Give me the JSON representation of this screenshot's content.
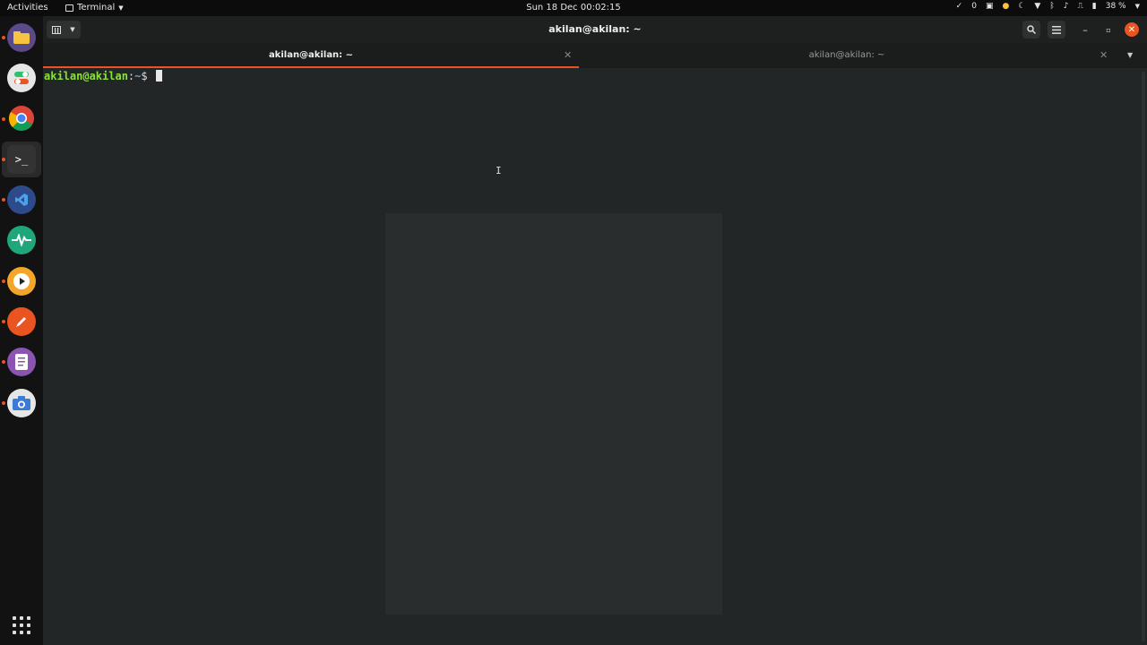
{
  "topbar": {
    "activities": "Activities",
    "app_name": "Terminal",
    "clock": "Sun 18 Dec  00:02:15",
    "notification_count": "0",
    "battery": "38 %"
  },
  "dock": {
    "items": [
      {
        "name": "files-icon",
        "color": "#f6c342"
      },
      {
        "name": "settings-toggle-icon",
        "color": "#e6e6e6"
      },
      {
        "name": "chrome-icon",
        "color": "#4285f4"
      },
      {
        "name": "terminal-icon",
        "color": "#333333"
      },
      {
        "name": "vscode-icon",
        "color": "#2d67b4"
      },
      {
        "name": "system-monitor-icon",
        "color": "#2fbf71"
      },
      {
        "name": "media-player-icon",
        "color": "#f4a62a"
      },
      {
        "name": "pen-tool-icon",
        "color": "#e95420"
      },
      {
        "name": "text-editor-icon",
        "color": "#8b54b0"
      },
      {
        "name": "screenshot-icon",
        "color": "#3a7bd5"
      }
    ]
  },
  "window": {
    "title": "akilan@akilan: ~",
    "tabs": [
      {
        "label": "akilan@akilan: ~",
        "active": true
      },
      {
        "label": "akilan@akilan: ~",
        "active": false
      }
    ]
  },
  "terminal": {
    "user_host": "akilan@akilan",
    "separator": ":",
    "path": "~",
    "prompt": "$ "
  },
  "colors": {
    "accent": "#e95420",
    "prompt_user": "#8ae234",
    "prompt_path": "#729fcf"
  }
}
